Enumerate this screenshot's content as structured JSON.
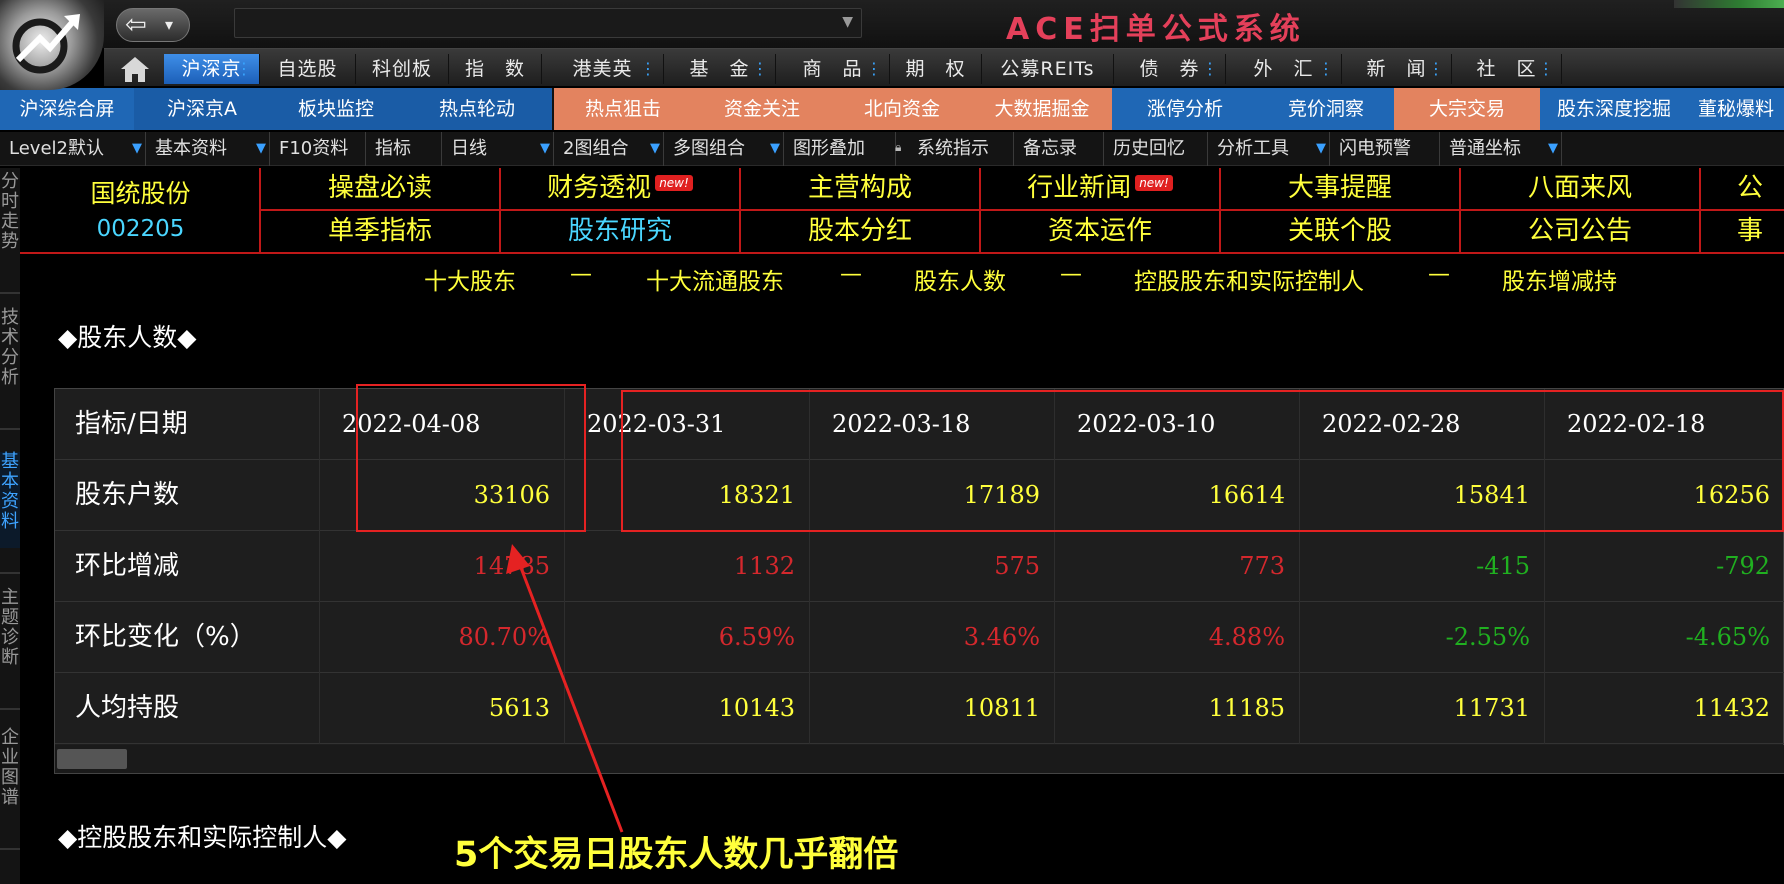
{
  "app": {
    "title": "ACE扫单公式系统"
  },
  "market_tabs": [
    {
      "label": "沪深京",
      "active": true
    },
    {
      "label": "自选股"
    },
    {
      "label": "科创板"
    },
    {
      "label": "指　数"
    },
    {
      "label": "港美英"
    },
    {
      "label": "基　金"
    },
    {
      "label": "商　品"
    },
    {
      "label": "期　权"
    },
    {
      "label": "公募REITs"
    },
    {
      "label": "债　券"
    },
    {
      "label": "外　汇"
    },
    {
      "label": "新　闻"
    },
    {
      "label": "社　区"
    }
  ],
  "feature_tabs": [
    {
      "label": "沪深综合屏"
    },
    {
      "label": "沪深京A"
    },
    {
      "label": "板块监控"
    },
    {
      "label": "热点轮动"
    },
    {
      "label": "热点狙击"
    },
    {
      "label": "资金关注"
    },
    {
      "label": "北向资金"
    },
    {
      "label": "大数据掘金"
    },
    {
      "label": "涨停分析"
    },
    {
      "label": "竞价洞察"
    },
    {
      "label": "大宗交易"
    },
    {
      "label": "股东深度挖掘"
    },
    {
      "label": "董秘爆料"
    }
  ],
  "toolbar": [
    {
      "label": "Level2默认"
    },
    {
      "label": "基本资料"
    },
    {
      "label": "F10资料"
    },
    {
      "label": "指标"
    },
    {
      "label": "日线"
    },
    {
      "label": "2图组合"
    },
    {
      "label": "多图组合"
    },
    {
      "label": "图形叠加"
    },
    {
      "label": "系统指示"
    },
    {
      "label": "备忘录"
    },
    {
      "label": "历史回忆"
    },
    {
      "label": "分析工具"
    },
    {
      "label": "闪电预警"
    },
    {
      "label": "普通坐标"
    }
  ],
  "side_tabs": [
    "分时走势",
    "技术分析",
    "基本资料",
    "主题诊断",
    "企业图谱"
  ],
  "stock": {
    "name": "国统股份",
    "code": "002205"
  },
  "f10_links": {
    "row1": [
      "操盘必读",
      "财务透视",
      "主营构成",
      "行业新闻",
      "大事提醒",
      "八面来风",
      "公"
    ],
    "row2": [
      "单季指标",
      "股东研究",
      "股本分红",
      "资本运作",
      "关联个股",
      "公司公告",
      "事"
    ],
    "new_badge": "new!"
  },
  "sub_nav": {
    "links": [
      "十大股东",
      "十大流通股东",
      "股东人数",
      "控股股东和实际控制人",
      "股东增减持"
    ],
    "separator": "—"
  },
  "sections": {
    "holders_title": "◆股东人数◆",
    "controller_title": "◆控股股东和实际控制人◆"
  },
  "holders_table": {
    "header_label": "指标/日期",
    "dates": [
      "2022-04-08",
      "2022-03-31",
      "2022-03-18",
      "2022-03-10",
      "2022-02-28",
      "2022-02-18"
    ],
    "rows": [
      {
        "label": "股东户数",
        "values": [
          "33106",
          "18321",
          "17189",
          "16614",
          "15841",
          "16256"
        ],
        "colors": [
          "yellow",
          "yellow",
          "yellow",
          "yellow",
          "yellow",
          "yellow"
        ]
      },
      {
        "label": "环比增减",
        "values": [
          "14785",
          "1132",
          "575",
          "773",
          "-415",
          "-792"
        ],
        "colors": [
          "red",
          "red",
          "red",
          "red",
          "green",
          "green"
        ]
      },
      {
        "label": "环比变化（%）",
        "values": [
          "80.70%",
          "6.59%",
          "3.46%",
          "4.88%",
          "-2.55%",
          "-4.65%"
        ],
        "colors": [
          "red",
          "red",
          "red",
          "red",
          "green",
          "green"
        ]
      },
      {
        "label": "人均持股",
        "values": [
          "5613",
          "10143",
          "10811",
          "11185",
          "11731",
          "11432"
        ],
        "colors": [
          "yellow",
          "yellow",
          "yellow",
          "yellow",
          "yellow",
          "yellow"
        ]
      }
    ]
  },
  "annotation": {
    "text": "5个交易日股东人数几乎翻倍"
  },
  "colors": {
    "accent_yellow": "#ffff3c",
    "up_red": "#d4282d",
    "down_green": "#20b020",
    "link_cyan": "#4ad6ff",
    "grid_red": "#c01818",
    "annotation_red": "#e52222"
  }
}
